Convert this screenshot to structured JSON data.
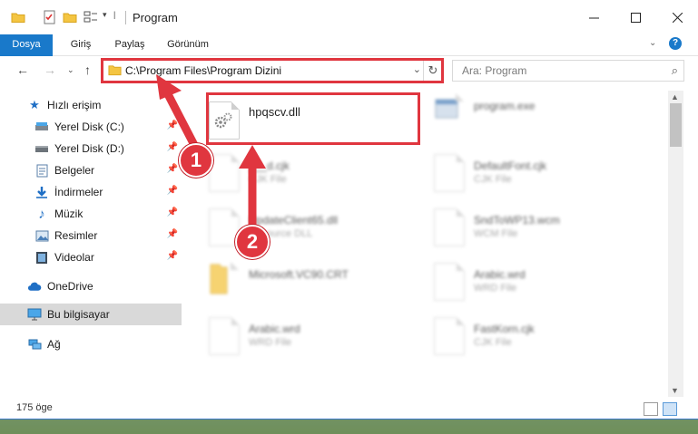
{
  "window": {
    "title": "Program"
  },
  "ribbon": {
    "tabs": [
      {
        "label": "Dosya"
      },
      {
        "label": "Giriş"
      },
      {
        "label": "Paylaş"
      },
      {
        "label": "Görünüm"
      }
    ]
  },
  "nav": {
    "address_path": "C:\\Program Files\\Program Dizini",
    "search_placeholder": "Ara: Program"
  },
  "sidebar": {
    "items": [
      {
        "label": "Hızlı erişim",
        "icon": "star-icon",
        "pinned": false
      },
      {
        "label": "Yerel Disk (C:)",
        "icon": "drive-c-icon",
        "pinned": true
      },
      {
        "label": "Yerel Disk (D:)",
        "icon": "drive-d-icon",
        "pinned": true
      },
      {
        "label": "Belgeler",
        "icon": "documents-icon",
        "pinned": true
      },
      {
        "label": "İndirmeler",
        "icon": "download-icon",
        "pinned": true
      },
      {
        "label": "Müzik",
        "icon": "music-icon",
        "pinned": true
      },
      {
        "label": "Resimler",
        "icon": "pictures-icon",
        "pinned": true
      },
      {
        "label": "Videolar",
        "icon": "videos-icon",
        "pinned": true
      },
      {
        "label": "OneDrive",
        "icon": "cloud-icon",
        "pinned": false
      },
      {
        "label": "Bu bilgisayar",
        "icon": "computer-icon",
        "pinned": false
      },
      {
        "label": "Ağ",
        "icon": "network-icon",
        "pinned": false
      }
    ]
  },
  "files": [
    {
      "name": "hpqscv.dll",
      "type": "",
      "icon": "dll-gear-icon"
    },
    {
      "name": "program.exe",
      "type": "",
      "icon": "exe-icon"
    },
    {
      "name": "___d.cjk",
      "type": "CJK File",
      "icon": "file-icon"
    },
    {
      "name": "DefaultFont.cjk",
      "type": "CJK File",
      "icon": "file-icon"
    },
    {
      "name": "UpdateClient65.dll",
      "type": "Resource DLL",
      "icon": "dll-gear-icon"
    },
    {
      "name": "SndToWP13.wcm",
      "type": "WCM File",
      "icon": "file-icon"
    },
    {
      "name": "Microsoft.VC90.CRT",
      "type": "",
      "icon": "folder-icon"
    },
    {
      "name": "Arabic.wrd",
      "type": "WRD File",
      "icon": "file-icon"
    },
    {
      "name": "Arabic.wrd",
      "type": "WRD File",
      "icon": "file-icon"
    },
    {
      "name": "FastKorn.cjk",
      "type": "CJK File",
      "icon": "file-icon"
    }
  ],
  "status": {
    "item_count": "175 öge"
  },
  "annotations": {
    "badge1": "1",
    "badge2": "2"
  },
  "colors": {
    "accent": "#1979ca",
    "highlight_red": "#e0363f",
    "folder_yellow": "#f4c542"
  }
}
